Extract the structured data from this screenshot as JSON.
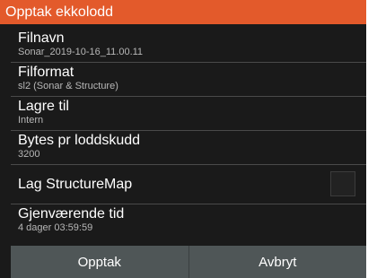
{
  "dialog": {
    "title": "Opptak ekkolodd",
    "colors": {
      "title_bar": "#e35a2b",
      "background": "#1a1a1a",
      "button_bar": "#4f5657"
    }
  },
  "fields": {
    "filename": {
      "label": "Filnavn",
      "value": "Sonar_2019-10-16_11.00.11"
    },
    "format": {
      "label": "Filformat",
      "value": "sl2 (Sonar & Structure)"
    },
    "save_to": {
      "label": "Lagre til",
      "value": "Intern"
    },
    "bytes_per_ping": {
      "label": "Bytes pr loddskudd",
      "value": "3200"
    },
    "structuremap": {
      "label": "Lag StructureMap",
      "checked": false
    },
    "time_remaining": {
      "label": "Gjenværende tid",
      "value": "4 dager 03:59:59"
    }
  },
  "buttons": {
    "record": "Opptak",
    "cancel": "Avbryt"
  }
}
